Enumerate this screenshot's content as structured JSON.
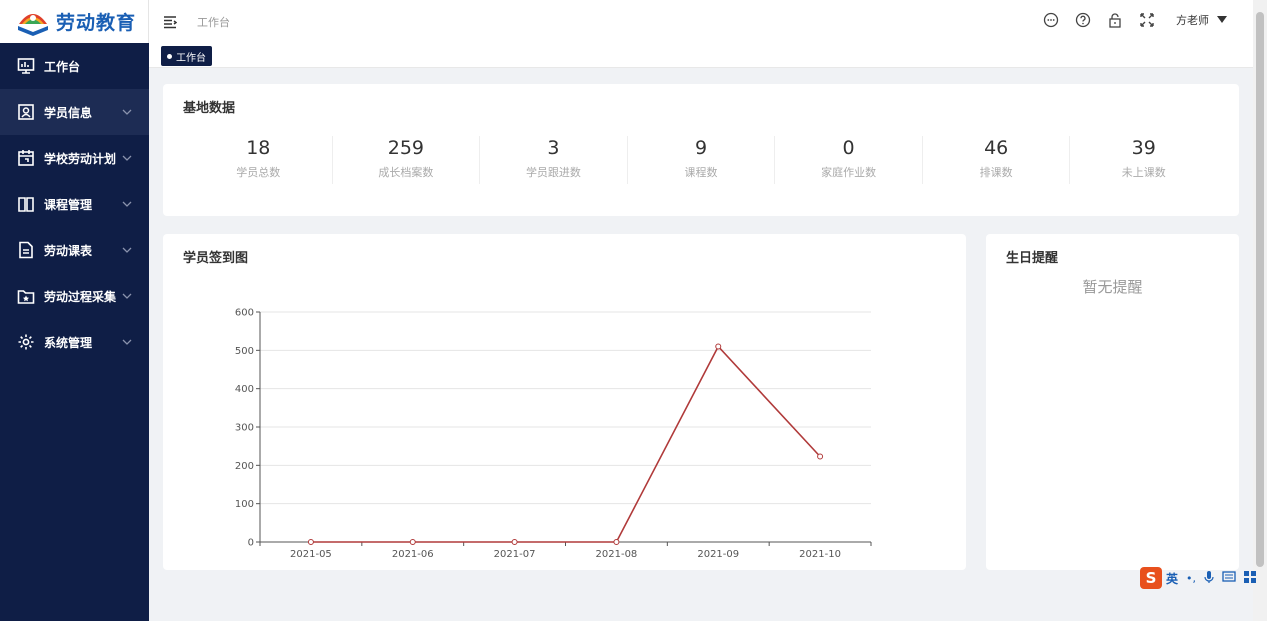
{
  "app": {
    "title": "劳动教育"
  },
  "sidebar": {
    "items": [
      {
        "label": "工作台",
        "icon": "monitor-icon"
      },
      {
        "label": "学员信息",
        "icon": "person-card-icon"
      },
      {
        "label": "学校劳动计划",
        "icon": "calendar-icon"
      },
      {
        "label": "课程管理",
        "icon": "book-icon"
      },
      {
        "label": "劳动课表",
        "icon": "document-icon"
      },
      {
        "label": "劳动过程采集",
        "icon": "folder-star-icon"
      },
      {
        "label": "系统管理",
        "icon": "gear-icon"
      }
    ]
  },
  "header": {
    "breadcrumb": "工作台",
    "user": "方老师"
  },
  "tags": {
    "active": "工作台"
  },
  "base_data": {
    "title": "基地数据",
    "stats": [
      {
        "value": "18",
        "label": "学员总数"
      },
      {
        "value": "259",
        "label": "成长档案数"
      },
      {
        "value": "3",
        "label": "学员跟进数"
      },
      {
        "value": "9",
        "label": "课程数"
      },
      {
        "value": "0",
        "label": "家庭作业数"
      },
      {
        "value": "46",
        "label": "排课数"
      },
      {
        "value": "39",
        "label": "未上课数"
      }
    ]
  },
  "checkin": {
    "title": "学员签到图"
  },
  "birthday": {
    "title": "生日提醒",
    "empty_text": "暂无提醒"
  },
  "ime": {
    "label": "英"
  },
  "chart_data": {
    "type": "line",
    "categories": [
      "2021-05",
      "2021-06",
      "2021-07",
      "2021-08",
      "2021-09",
      "2021-10"
    ],
    "values": [
      0,
      0,
      0,
      0,
      510,
      223
    ],
    "ylim": [
      0,
      600
    ],
    "yticks": [
      0,
      100,
      200,
      300,
      400,
      500,
      600
    ],
    "grid": true,
    "color": "#b03a3a"
  }
}
